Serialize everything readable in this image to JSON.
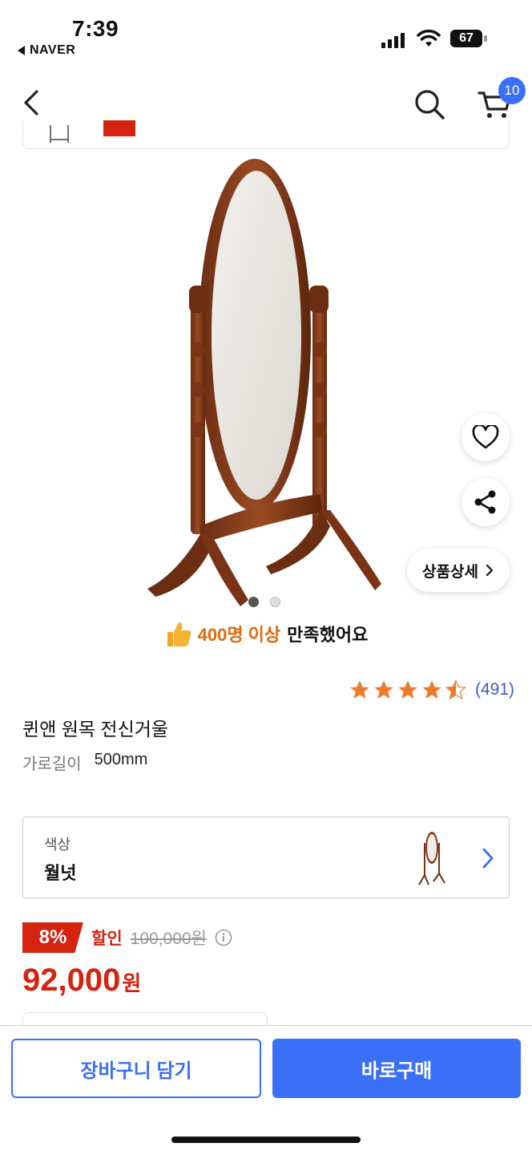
{
  "status_bar": {
    "time": "7:39",
    "back_app": "NAVER",
    "battery": "67"
  },
  "nav": {
    "icons": [
      "back-icon",
      "search-icon",
      "cart-icon"
    ],
    "cart_badge": "10"
  },
  "gallery": {
    "dot_count": 2,
    "active_index": 0
  },
  "floating": {
    "detail_label": "상품상세"
  },
  "satisfaction": {
    "highlight": "400명 이상",
    "text": "만족했어요"
  },
  "rating": {
    "stars": 4.5,
    "count": "(491)"
  },
  "product": {
    "title": "퀸앤 원목 전신거울",
    "spec_key": "가로길이",
    "spec_value": "500mm"
  },
  "option": {
    "label": "색상",
    "value": "월넛"
  },
  "pricing": {
    "discount": "8%",
    "discount_label": "할인",
    "original": "100,000원",
    "price": "92,000",
    "unit": "원"
  },
  "actions": {
    "cart": "장바구니 담기",
    "buy": "바로구매"
  },
  "colors": {
    "accent": "#3a6ff7",
    "sale": "#d4230f",
    "satisfied": "#e06a0c",
    "star": "#f07a2c"
  }
}
